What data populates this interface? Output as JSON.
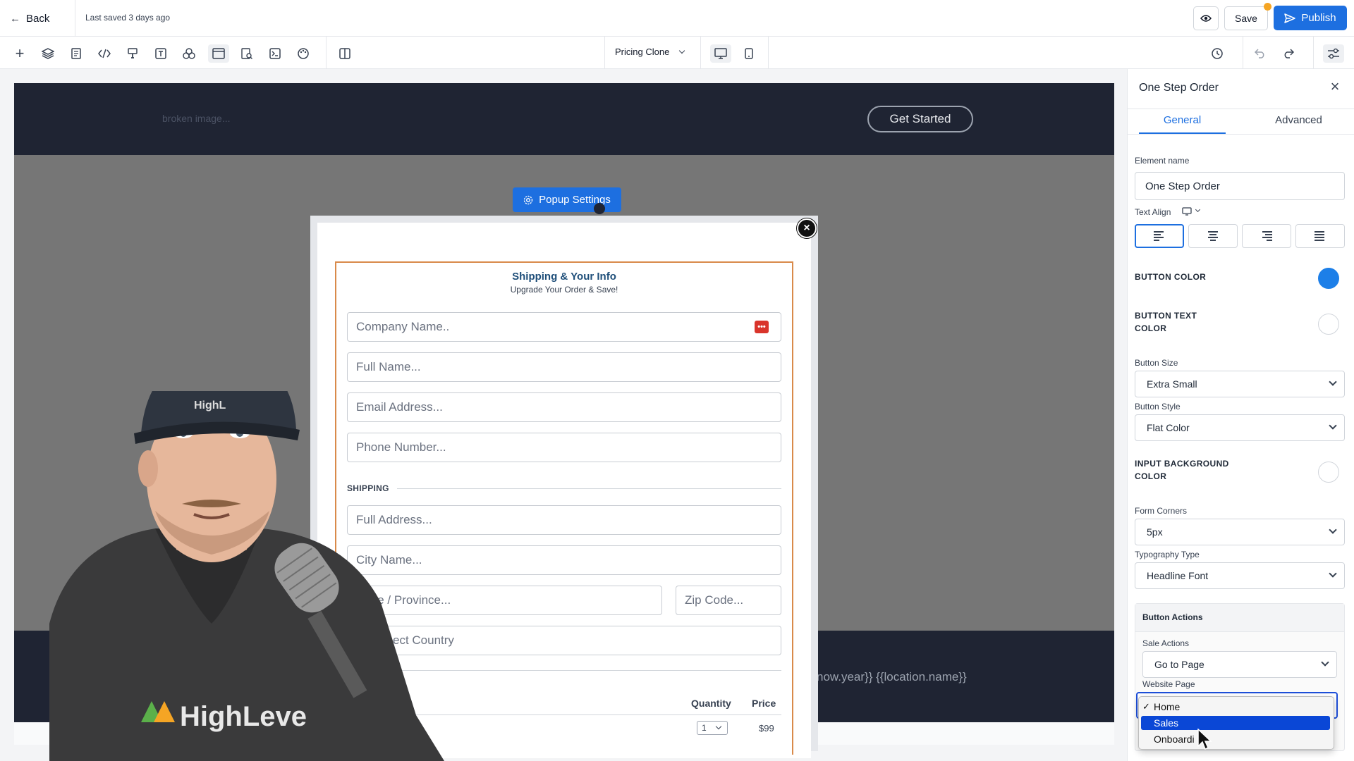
{
  "topbar": {
    "back_label": "Back",
    "last_saved": "Last saved 3 days ago",
    "save_label": "Save",
    "publish_label": "Publish"
  },
  "toolbar": {
    "page_select": "Pricing Clone"
  },
  "canvas": {
    "logo_alt": "broken image...",
    "header_button": "Get Started",
    "popup_settings_label": "Popup Settings",
    "footer_text": "now.year}} {{location.name}}"
  },
  "form": {
    "title": "Shipping & Your Info",
    "subtitle": "Upgrade Your Order & Save!",
    "placeholders": {
      "company": "Company Name..",
      "full_name": "Full Name...",
      "email": "Email Address...",
      "phone": "Phone Number...",
      "address": "Full Address...",
      "city": "City Name...",
      "state": "State / Province...",
      "zip": "Zip Code...",
      "country": "ect Country"
    },
    "shipping_heading": "SHIPPING",
    "quantity_header": "Quantity",
    "price_header": "Price",
    "quantity_value": "1",
    "price_value": "$99"
  },
  "panel": {
    "title": "One Step Order",
    "tabs": [
      "General",
      "Advanced"
    ],
    "element_name_label": "Element name",
    "element_name_value": "One Step Order",
    "text_align_label": "Text Align",
    "button_color_label": "BUTTON COLOR",
    "button_color": "#1d7fe8",
    "button_text_color_label": "BUTTON TEXT COLOR",
    "button_size_label": "Button Size",
    "button_size_value": "Extra Small",
    "button_style_label": "Button Style",
    "button_style_value": "Flat Color",
    "input_bg_label": "INPUT BACKGROUND COLOR",
    "form_corners_label": "Form Corners",
    "form_corners_value": "5px",
    "typography_label": "Typography Type",
    "typography_value": "Headline Font",
    "button_actions_label": "Button Actions",
    "sale_actions_label": "Sale Actions",
    "sale_actions_value": "Go to Page",
    "website_page_label": "Website Page",
    "dropdown_options": [
      "Home",
      "Sales",
      "Onboardi"
    ],
    "dropdown_checked": "Home",
    "dropdown_highlighted": "Sales"
  },
  "presenter": {
    "hoodie_text": "HighLeve",
    "cap_text": "HighL"
  },
  "colors": {
    "accent": "#1d6fe0",
    "canvas_dark": "#1f2433",
    "form_border": "#d98a4a",
    "form_title": "#1e4e79"
  }
}
